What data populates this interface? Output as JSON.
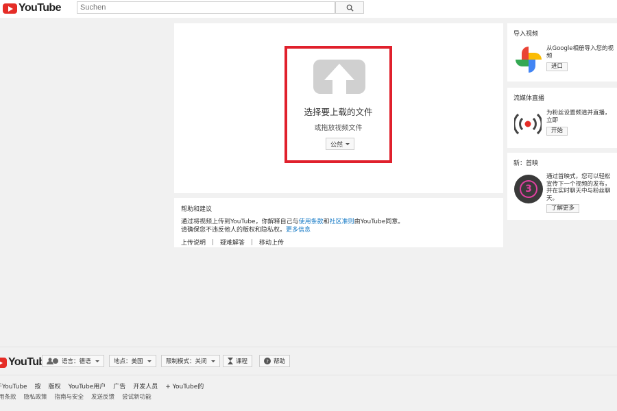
{
  "header": {
    "logo_text": "YouTube",
    "search_placeholder": "Suchen"
  },
  "upload": {
    "title": "选择要上载的文件",
    "subtitle": "或拖放视频文件",
    "privacy_label": "公然"
  },
  "help": {
    "title": "帮助和建议",
    "line1_a": "通过将视频上传到YouTube，你解释自己与",
    "link_terms": "使用条款",
    "line1_b": "和",
    "link_guidelines": "社区准则",
    "line1_c": "由YouTube同意。",
    "line2": "请确保您不违反他人的版权和隐私权。",
    "link_more": "更多信息",
    "links": [
      "上传说明",
      "疑难解答",
      "移动上传"
    ]
  },
  "side": {
    "import": {
      "title": "导入视频",
      "text": "从Google相册导入您的视频",
      "button": "进口"
    },
    "live": {
      "title": "流媒体直播",
      "text": "为粉丝设置频道并直播，立即",
      "button": "开始"
    },
    "premiere": {
      "title": "新：首映",
      "text": "通过首映式，您可以轻松宣传下一个视频的发布，并在实时聊天中与粉丝聊天。",
      "button": "了解更多",
      "badge_number": "3"
    }
  },
  "footer": {
    "logo_text": "YouTube",
    "language": "语言：德语",
    "location": "地点：美国",
    "restricted": "限制模式：关闭",
    "history": "课程",
    "help": "帮助",
    "links1": [
      "于YouTube",
      "按",
      "版权",
      "YouTube用户",
      "广告",
      "开发人员",
      "+ YouTube的"
    ],
    "links2": [
      "用条款",
      "隐私政策",
      "指南与安全",
      "发送反馈",
      "尝试新功能"
    ]
  },
  "colors": {
    "brand_red": "#e52d27",
    "dropzone_border": "#e0202c",
    "link": "#167ac6"
  }
}
